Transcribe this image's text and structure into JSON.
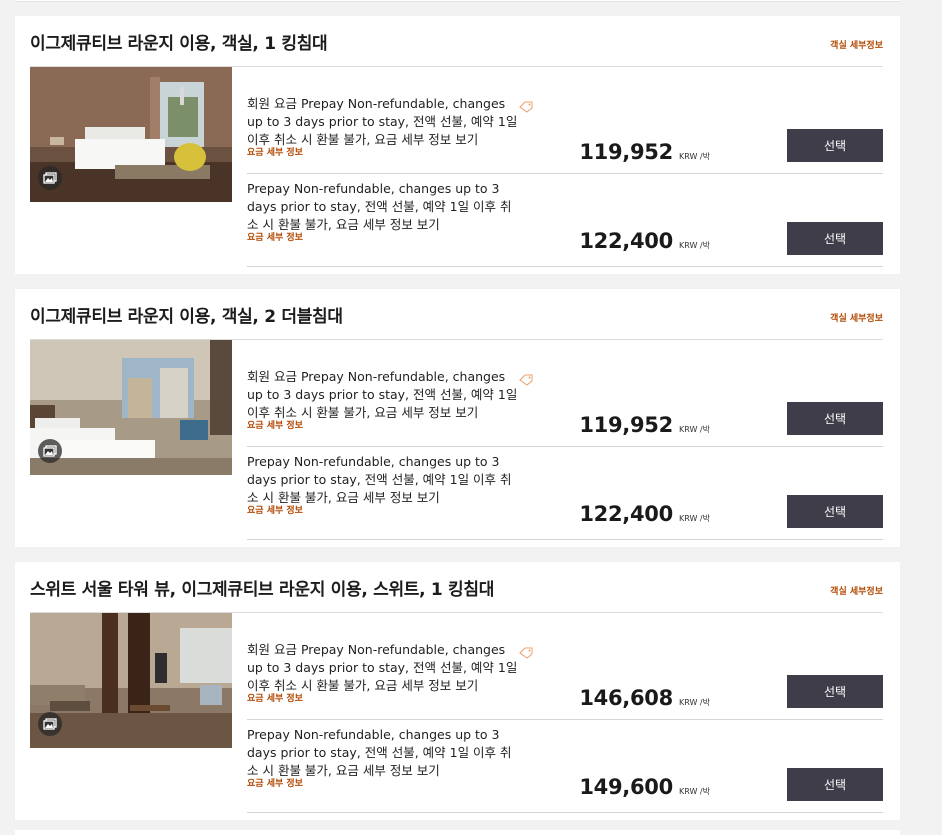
{
  "rooms": [
    {
      "title": "이그제큐티브 라운지 이용, 객실, 1 킹침대",
      "details_link": "객실 세부정보",
      "photo": "king-room",
      "gallery_icon": "photo-gallery-icon",
      "rates": [
        {
          "description": "회원 요금 Prepay Non-refundable, changes up to 3 days prior to stay, 전액 선불, 예약 1일 이후 취소 시 환불 불가, 요금 세부 정보 보기",
          "detail_link": "요금 세부 정보",
          "member_tag": true,
          "price": "119,952",
          "unit": "KRW /박",
          "button": "선택"
        },
        {
          "description": "Prepay Non-refundable, changes up to 3 days prior to stay, 전액 선불, 예약 1일 이후 취소 시 환불 불가, 요금 세부 정보 보기",
          "detail_link": "요금 세부 정보",
          "member_tag": false,
          "price": "122,400",
          "unit": "KRW /박",
          "button": "선택"
        }
      ]
    },
    {
      "title": "이그제큐티브 라운지 이용, 객실, 2 더블침대",
      "details_link": "객실 세부정보",
      "photo": "double-room",
      "gallery_icon": "photo-gallery-icon",
      "rates": [
        {
          "description": "회원 요금 Prepay Non-refundable, changes up to 3 days prior to stay, 전액 선불, 예약 1일 이후 취소 시 환불 불가, 요금 세부 정보 보기",
          "detail_link": "요금 세부 정보",
          "member_tag": true,
          "price": "119,952",
          "unit": "KRW /박",
          "button": "선택"
        },
        {
          "description": "Prepay Non-refundable, changes up to 3 days prior to stay, 전액 선불, 예약 1일 이후 취소 시 환불 불가, 요금 세부 정보 보기",
          "detail_link": "요금 세부 정보",
          "member_tag": false,
          "price": "122,400",
          "unit": "KRW /박",
          "button": "선택"
        }
      ]
    },
    {
      "title": "스위트 서울 타워 뷰, 이그제큐티브 라운지 이용, 스위트, 1 킹침대",
      "details_link": "객실 세부정보",
      "photo": "suite-room",
      "gallery_icon": "photo-gallery-icon",
      "rates": [
        {
          "description": "회원 요금 Prepay Non-refundable, changes up to 3 days prior to stay, 전액 선불, 예약 1일 이후 취소 시 환불 불가, 요금 세부 정보 보기",
          "detail_link": "요금 세부 정보",
          "member_tag": true,
          "price": "146,608",
          "unit": "KRW /박",
          "button": "선택"
        },
        {
          "description": "Prepay Non-refundable, changes up to 3 days prior to stay, 전액 선불, 예약 1일 이후 취소 시 환불 불가, 요금 세부 정보 보기",
          "detail_link": "요금 세부 정보",
          "member_tag": false,
          "price": "149,600",
          "unit": "KRW /박",
          "button": "선택"
        }
      ]
    }
  ],
  "colors": {
    "accent_link": "#b24a05",
    "button_bg": "#3f3d4a",
    "page_bg": "#f2f2f2"
  }
}
